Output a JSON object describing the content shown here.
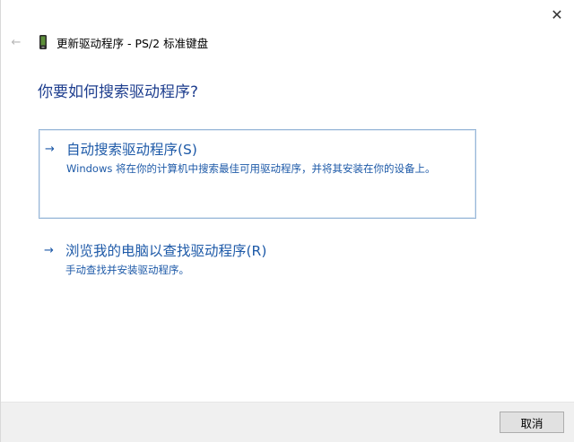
{
  "window": {
    "title": "更新驱动程序 - PS/2 标准键盘",
    "close_glyph": "✕",
    "back_glyph": "←",
    "device_icon": "keyboard-device-icon"
  },
  "main": {
    "heading": "你要如何搜索驱动程序?",
    "options": [
      {
        "arrow": "→",
        "title": "自动搜索驱动程序(S)",
        "description": "Windows 将在你的计算机中搜索最佳可用驱动程序，并将其安装在你的设备上。",
        "selected": true
      },
      {
        "arrow": "→",
        "title": "浏览我的电脑以查找驱动程序(R)",
        "description": "手动查找并安装驱动程序。",
        "selected": false
      }
    ]
  },
  "footer": {
    "cancel_label": "取消"
  },
  "colors": {
    "link": "#1e5aa8",
    "heading": "#1f3f8f",
    "footer_bg": "#f0f0f0",
    "selection_border": "#98b7d8"
  }
}
